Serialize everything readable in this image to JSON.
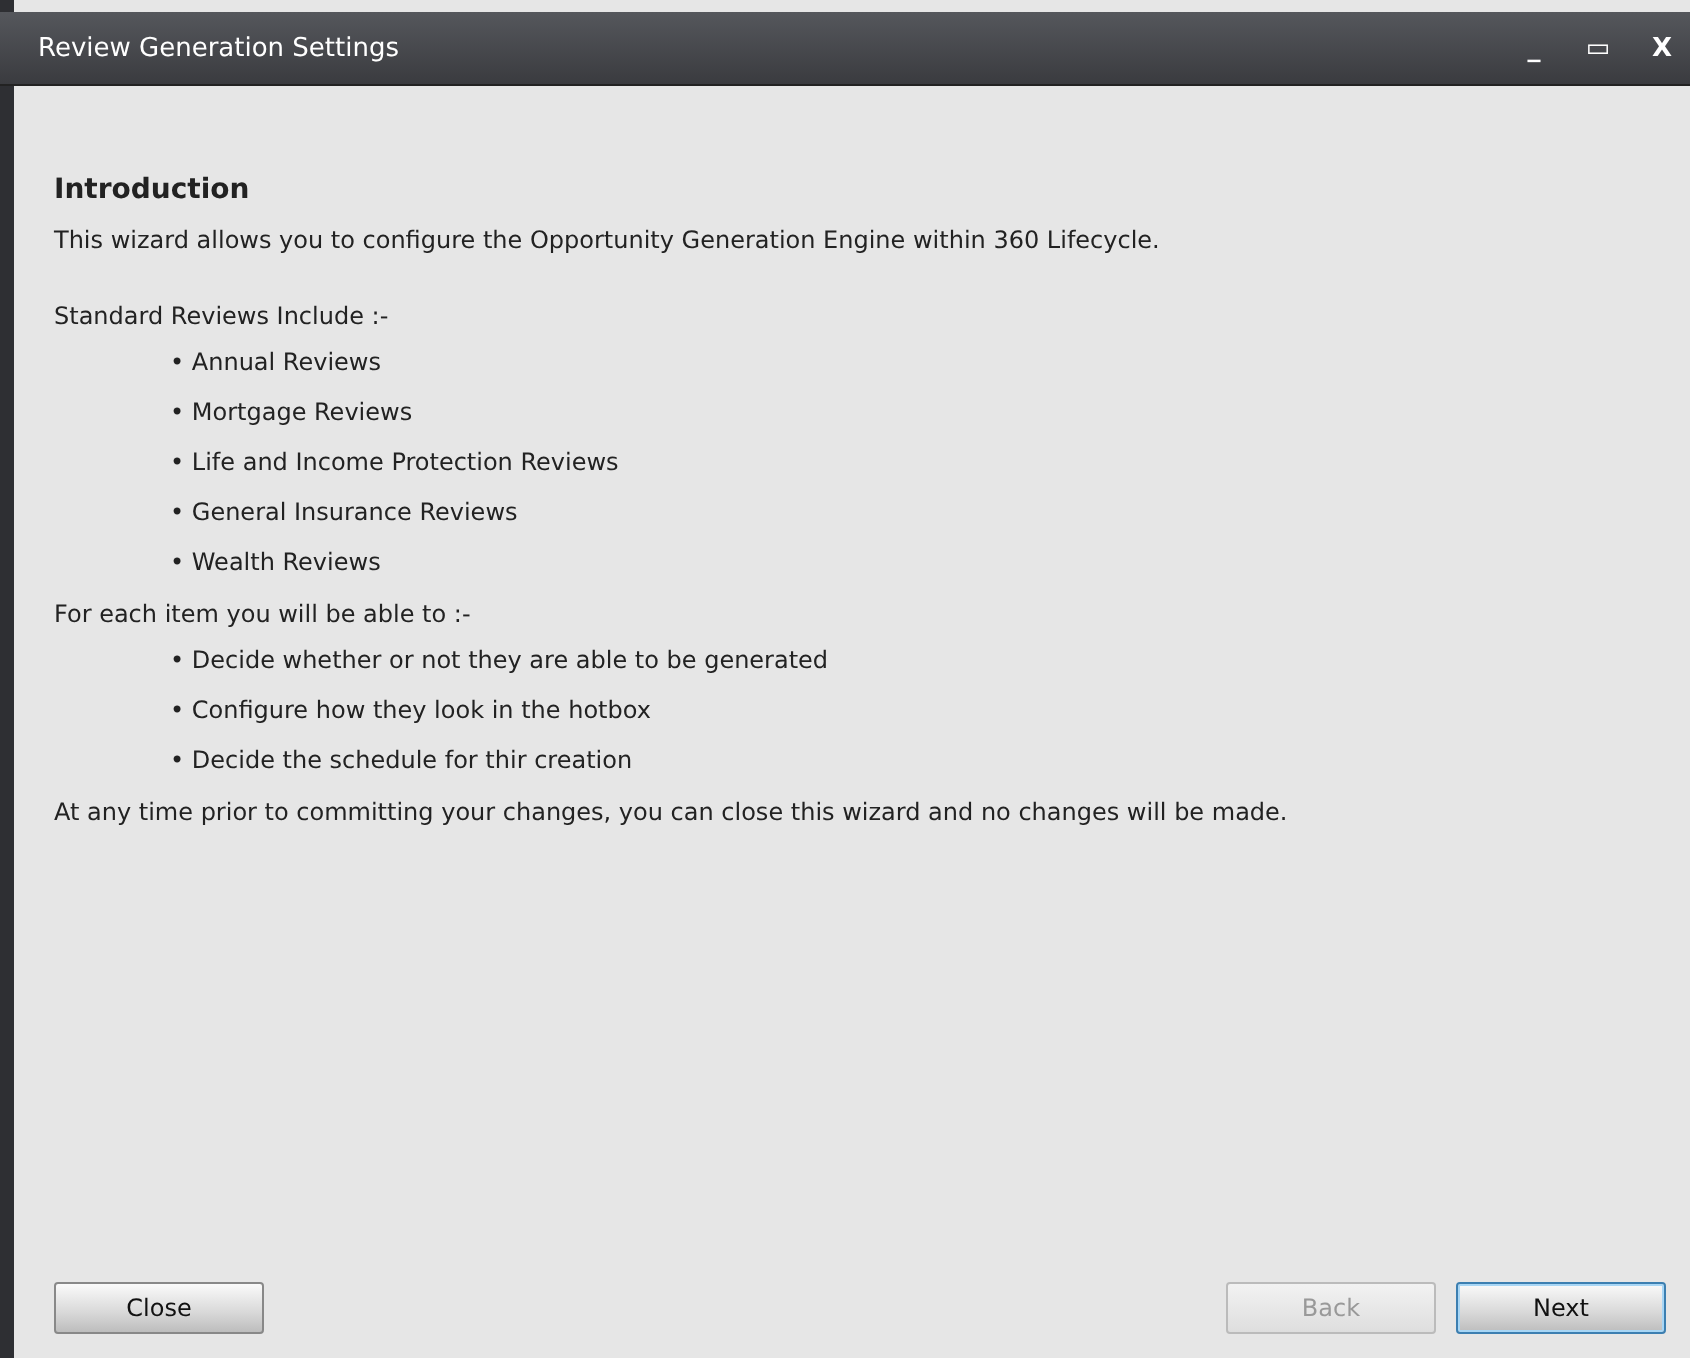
{
  "window": {
    "title": "Review Generation Settings",
    "controls": [
      "_",
      "▭",
      "X"
    ]
  },
  "heading": "Introduction",
  "intro": "This wizard allows you to configure the Opportunity Generation Engine within 360 Lifecycle.",
  "sections": [
    {
      "label": "Standard Reviews Include :-",
      "items": [
        "• Annual Reviews",
        "• Mortgage Reviews",
        "• Life and Income Protection Reviews",
        "• General Insurance Reviews",
        "• Wealth Reviews"
      ]
    },
    {
      "label": "For each item you will be able to :-",
      "items": [
        "• Decide whether or not they are able to be generated",
        "• Configure how they look in the hotbox",
        "• Decide the schedule for thir creation"
      ]
    }
  ],
  "footer_note": "At any time prior to committing your changes, you can close this wizard and no changes will be made.",
  "left_buttons": [
    {
      "label": "Close",
      "disabled": false,
      "default": false
    }
  ],
  "right_buttons": [
    {
      "label": "Back",
      "disabled": true,
      "default": false
    },
    {
      "label": "Next",
      "disabled": false,
      "default": true
    }
  ]
}
